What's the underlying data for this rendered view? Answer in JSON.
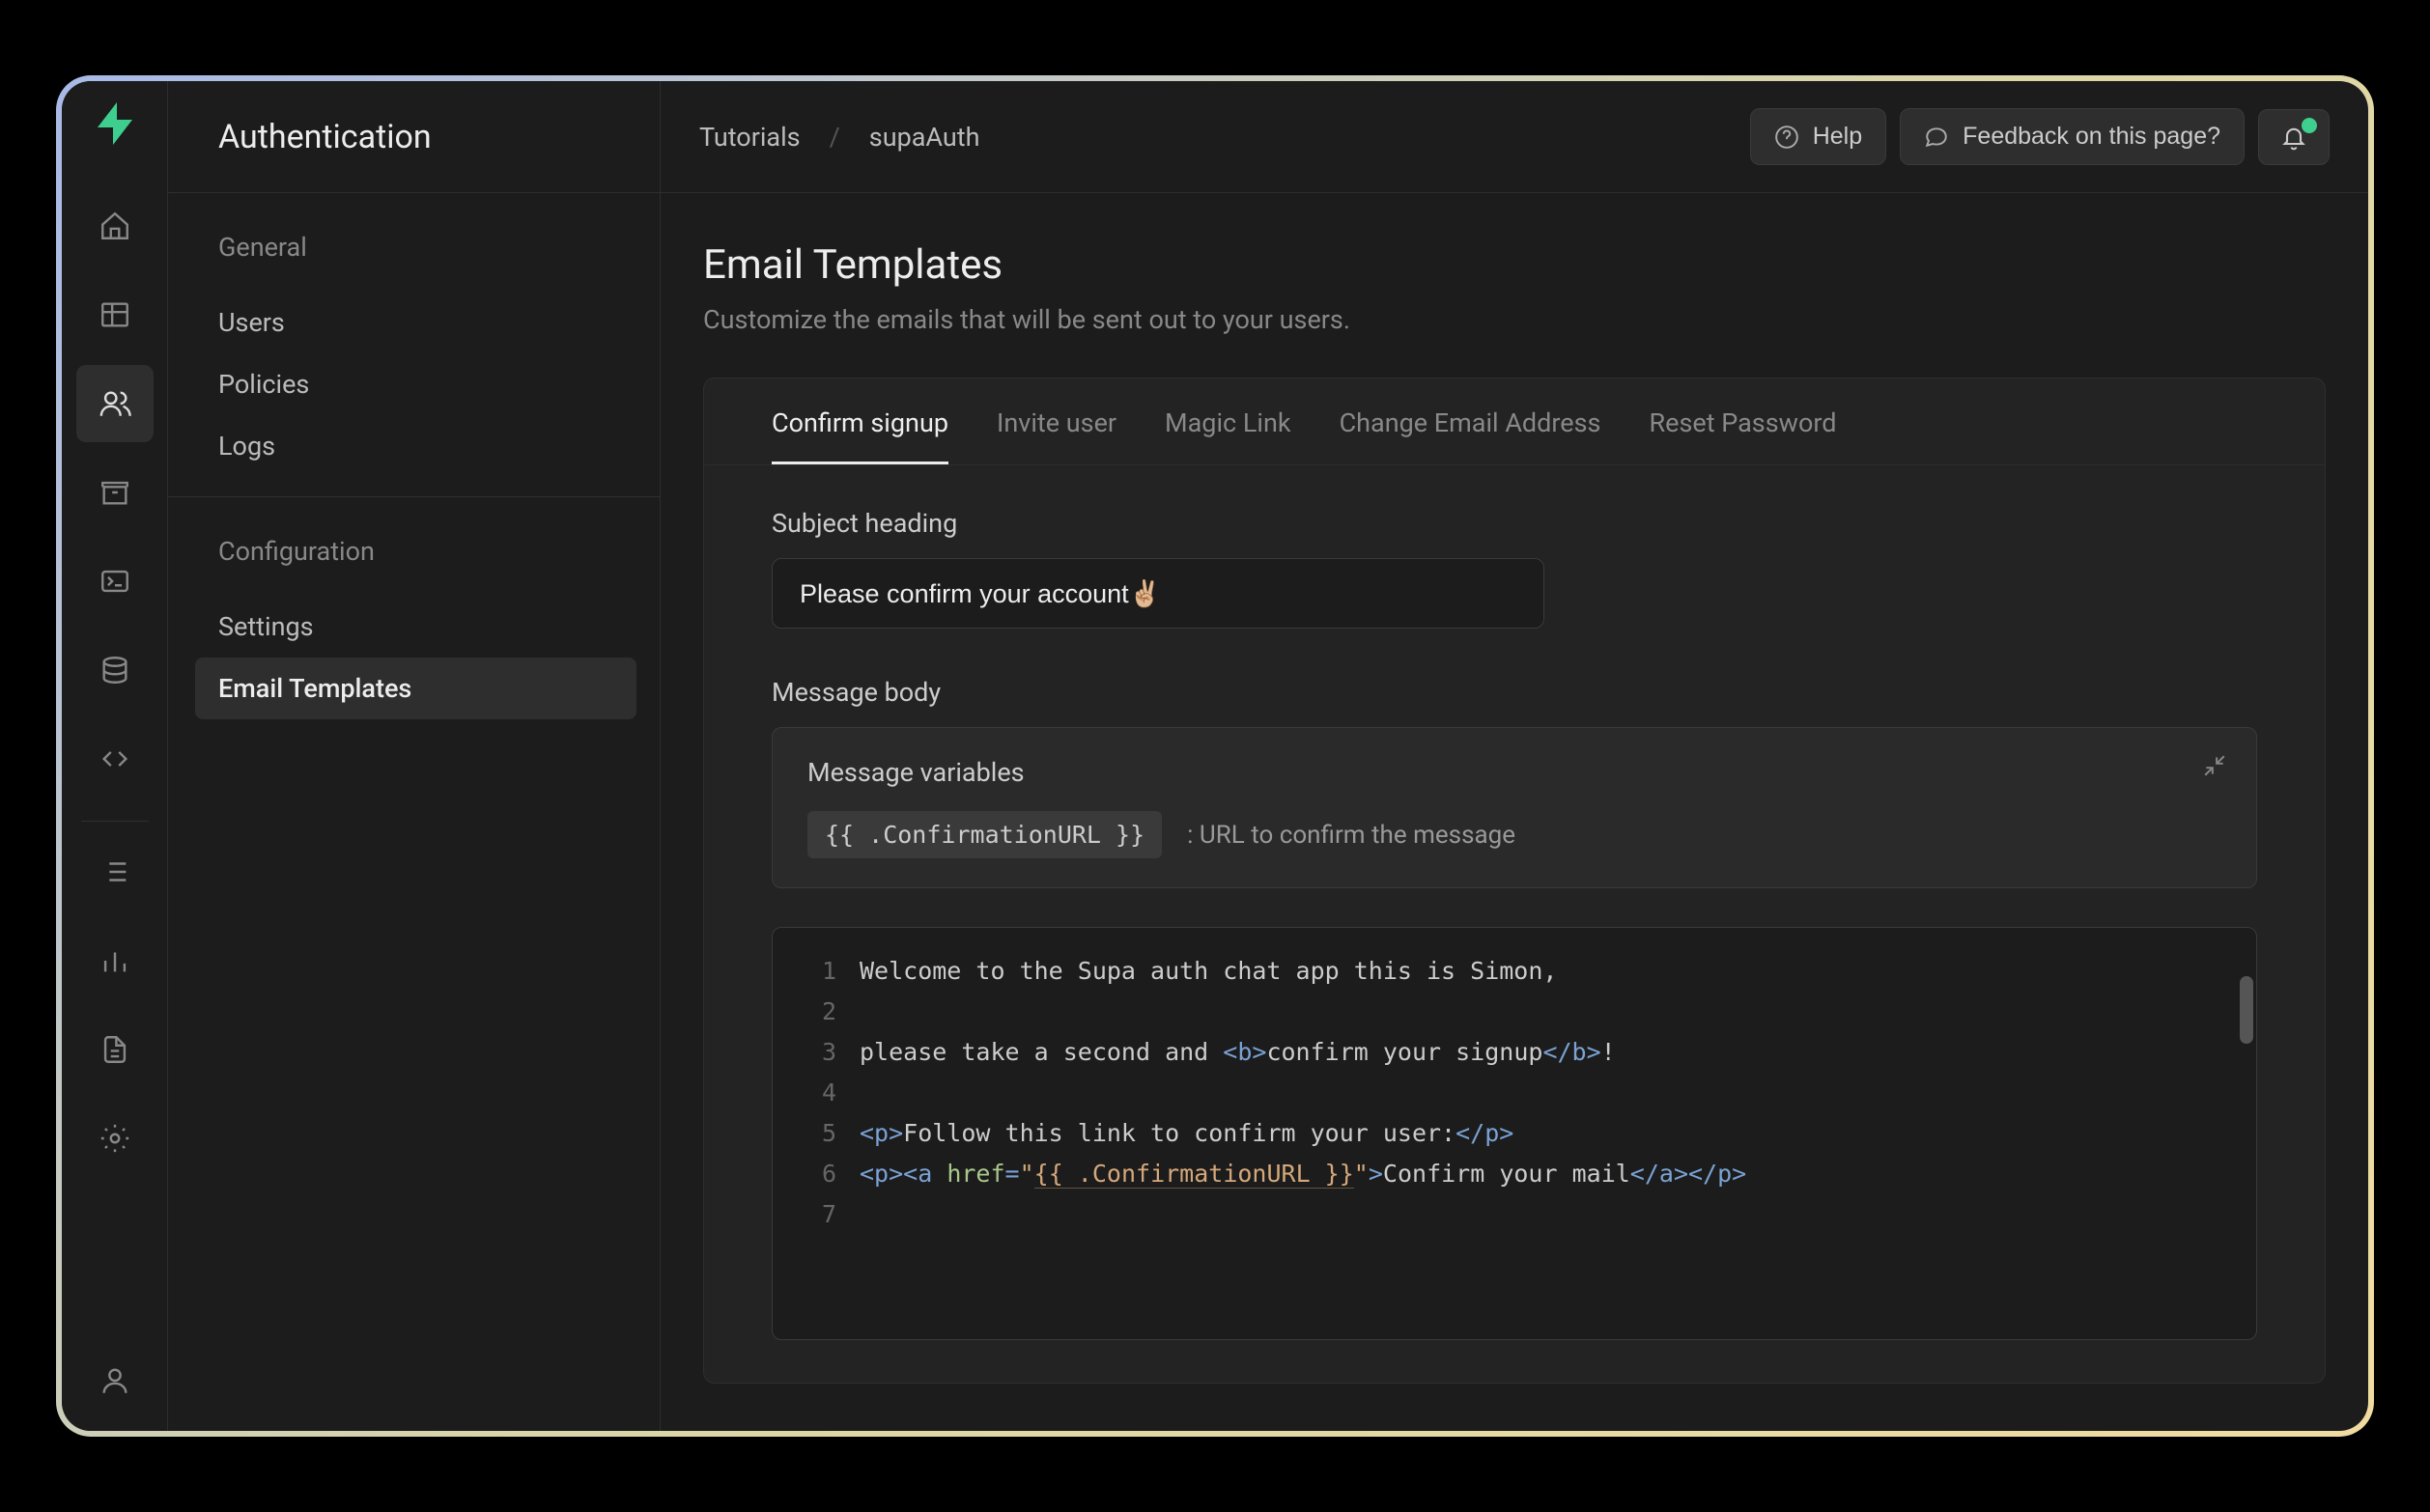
{
  "brand_color": "#3ecf8e",
  "section_title": "Authentication",
  "breadcrumb": {
    "root": "Tutorials",
    "project": "supaAuth"
  },
  "topbar": {
    "help": "Help",
    "feedback": "Feedback on this page?",
    "has_notification": true
  },
  "sidebar": {
    "groups": [
      {
        "title": "General",
        "items": [
          {
            "label": "Users",
            "active": false
          },
          {
            "label": "Policies",
            "active": false
          },
          {
            "label": "Logs",
            "active": false
          }
        ]
      },
      {
        "title": "Configuration",
        "items": [
          {
            "label": "Settings",
            "active": false
          },
          {
            "label": "Email Templates",
            "active": true
          }
        ]
      }
    ]
  },
  "rail_icons": [
    "home-icon",
    "table-icon",
    "auth-icon",
    "storage-icon",
    "terminal-icon",
    "database-icon",
    "api-icon",
    "list-icon",
    "reports-icon",
    "docs-icon",
    "settings-icon"
  ],
  "page": {
    "title": "Email Templates",
    "subtitle": "Customize the emails that will be sent out to your users."
  },
  "tabs": [
    {
      "label": "Confirm signup",
      "active": true
    },
    {
      "label": "Invite user",
      "active": false
    },
    {
      "label": "Magic Link",
      "active": false
    },
    {
      "label": "Change Email Address",
      "active": false
    },
    {
      "label": "Reset Password",
      "active": false
    }
  ],
  "form": {
    "subject_label": "Subject heading",
    "subject_value": "Please confirm your account✌🏼",
    "body_label": "Message body",
    "vars_title": "Message variables",
    "variable_name": "{{ .ConfirmationURL }}",
    "variable_desc": ": URL to confirm the message"
  },
  "code": {
    "line1": "Welcome to the Supa auth chat app this is Simon,",
    "line3_a": "please take a second and ",
    "line3_b": "confirm your signup",
    "line3_c": "!",
    "line5": "Follow this link to confirm your user:",
    "line6_url": "{{ .ConfirmationURL }}",
    "line6_text": "Confirm your mail"
  }
}
